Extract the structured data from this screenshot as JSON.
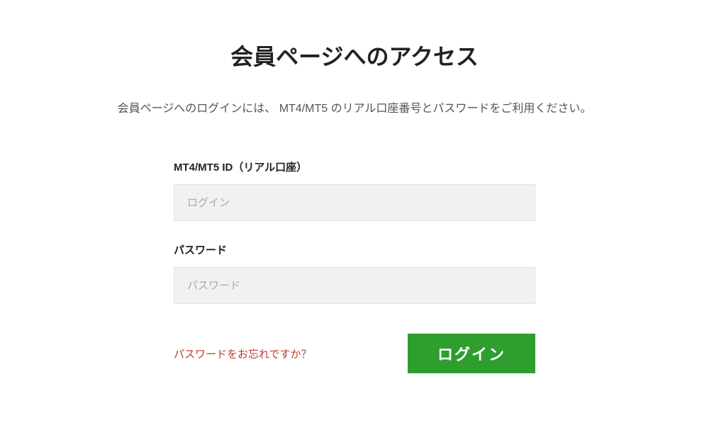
{
  "header": {
    "title": "会員ページへのアクセス",
    "description": "会員ページへのログインには、 MT4/MT5 のリアル口座番号とパスワードをご利用ください。"
  },
  "form": {
    "id_field": {
      "label": "MT4/MT5 ID（リアル口座）",
      "placeholder": "ログイン",
      "value": ""
    },
    "password_field": {
      "label": "パスワード",
      "placeholder": "パスワード",
      "value": ""
    },
    "forgot_link": "パスワードをお忘れですか？",
    "login_button": "ログイン"
  },
  "colors": {
    "accent_green": "#2e9e2e",
    "link_red": "#c0392b",
    "input_bg": "#f1f1f1"
  }
}
